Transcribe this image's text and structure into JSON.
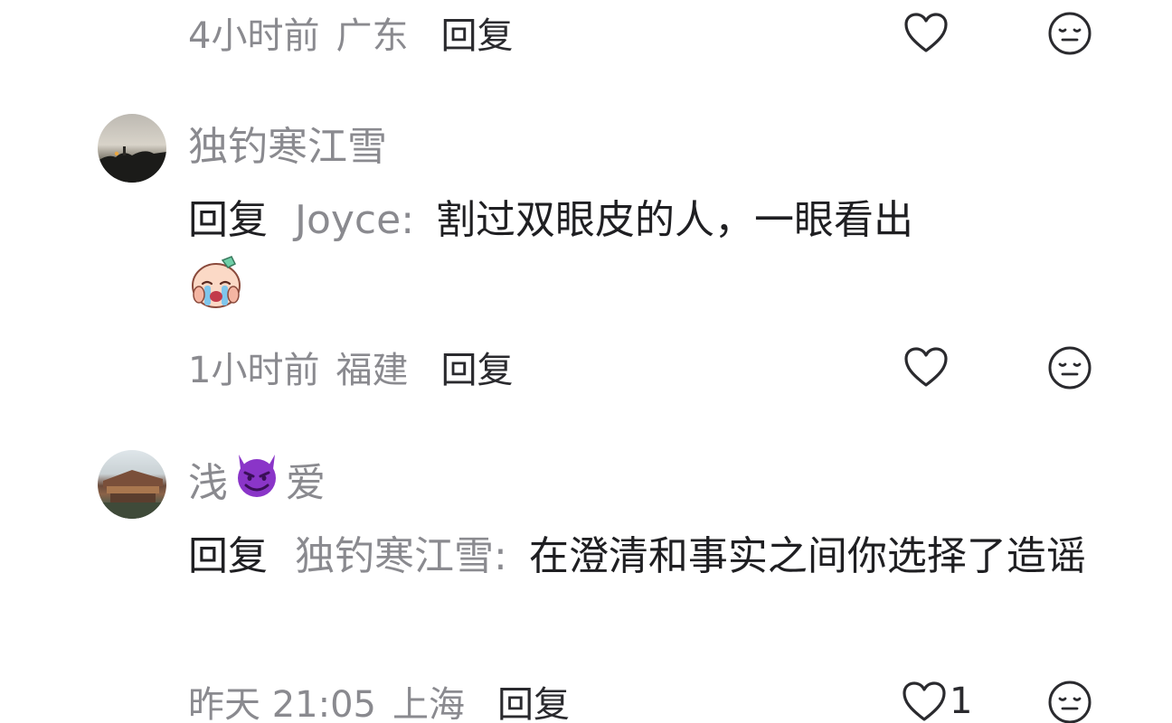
{
  "comments": [
    {
      "time": "4小时前",
      "location": "广东",
      "reply_label": "回复",
      "likes": ""
    },
    {
      "username": "独钓寒江雪",
      "reply_prefix": "回复",
      "reply_target": "Joyce",
      "colon": ":",
      "text": "割过双眼皮的人，一眼看出",
      "emoji": "crying-baby-emoji",
      "time": "1小时前",
      "location": "福建",
      "reply_label": "回复",
      "likes": ""
    },
    {
      "username_part1": "浅",
      "username_emoji": "purple-devil-emoji",
      "username_part2": "爱",
      "reply_prefix": "回复",
      "reply_target": "独钓寒江雪",
      "colon": ":",
      "text": "在澄清和事实之间你选择了造谣",
      "time": "昨天 21:05",
      "location": "上海",
      "reply_label": "回复",
      "likes": "1"
    }
  ],
  "icons": {
    "like": "heart-outline-icon",
    "dislike": "meh-face-icon"
  },
  "colors": {
    "meta_gray": "#8a8a8f",
    "text_dark": "#1f1f22",
    "devil_purple": "#8a35c8"
  }
}
